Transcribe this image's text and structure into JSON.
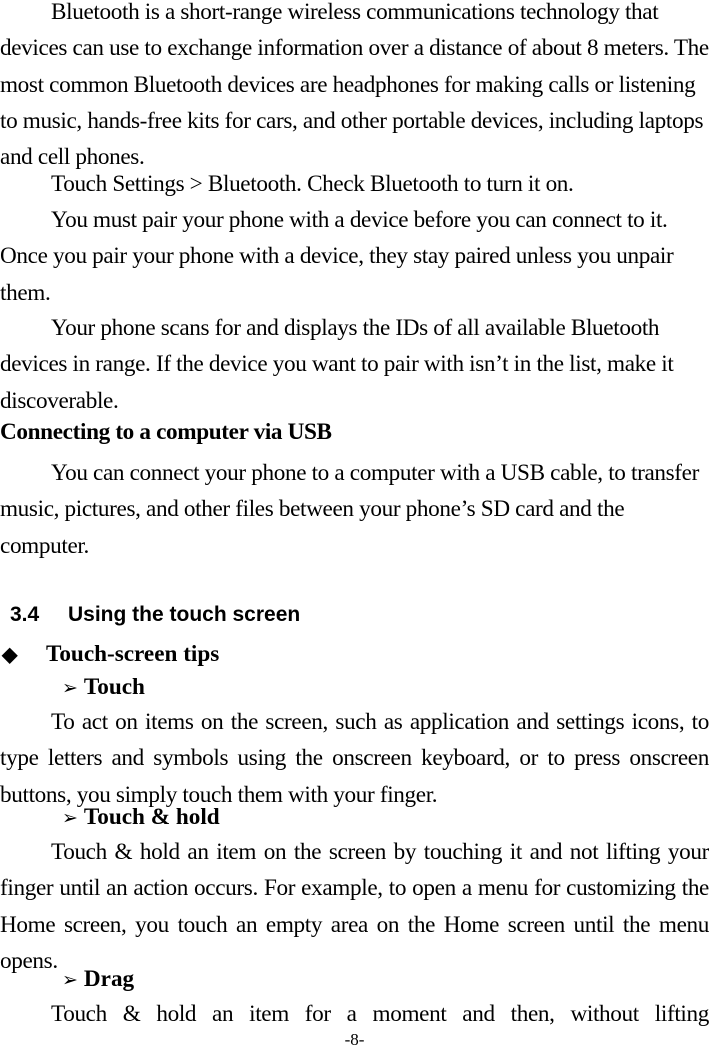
{
  "paragraphs": {
    "p1": "Bluetooth is a short-range wireless communications technology that devices can use to exchange information over a distance of about 8 meters. The most common Bluetooth devices are headphones for making calls or listening to music, hands-free kits for cars, and other portable devices, including laptops and cell phones.",
    "p2": "Touch Settings > Bluetooth. Check Bluetooth to turn it on.",
    "p3": "You must pair your phone with a device before you can connect to it. Once you pair your phone with a device, they stay paired unless you unpair them.",
    "p4": "Your phone scans for and displays the IDs of all available Bluetooth devices in range. If the device you want to pair with isn’t in the list, make it discoverable.",
    "h_usb": "Connecting to a computer via USB",
    "p5": "You can connect your phone to a computer with a USB cable, to transfer music, pictures, and other files between your phone’s SD card and the computer."
  },
  "section": {
    "number": "3.4",
    "title": "Using the touch screen"
  },
  "tips": {
    "bullet_glyph": "◆",
    "title": "Touch-screen tips",
    "sub_glyph": "➢",
    "items": [
      {
        "title": "Touch",
        "text": "To act on items on the screen, such as application and settings icons, to type letters and symbols using the onscreen keyboard, or to press onscreen buttons, you simply touch them with your finger."
      },
      {
        "title": "Touch & hold",
        "text": "Touch & hold an item on the screen by touching it and not lifting your finger until an action occurs. For example, to open a menu for customizing the Home screen, you touch an empty area on the Home screen until the menu opens."
      },
      {
        "title": "Drag",
        "text": "Touch & hold an item for a moment and then, without lifting"
      }
    ]
  },
  "footer": {
    "page_number": "-8-"
  }
}
